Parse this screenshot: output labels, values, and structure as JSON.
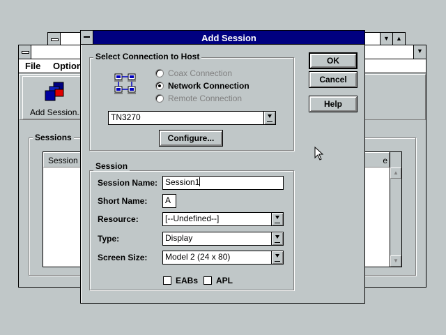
{
  "back_window": {
    "menu": {
      "file": "File",
      "options": "Option"
    },
    "toolbar": {
      "add_session_label": "Add Session..."
    },
    "sessions_group": {
      "title": "Sessions",
      "column_session": "Session N",
      "column_right": "e"
    }
  },
  "dialog": {
    "title": "Add Session",
    "connection_group": {
      "title": "Select Connection to Host",
      "radios": [
        {
          "label": "Coax Connection",
          "selected": false,
          "enabled": false
        },
        {
          "label": "Network Connection",
          "selected": true,
          "enabled": true
        },
        {
          "label": "Remote Connection",
          "selected": false,
          "enabled": false
        }
      ],
      "protocol": "TN3270",
      "configure_label": "Configure..."
    },
    "session_group": {
      "title": "Session",
      "session_name_label": "Session Name:",
      "session_name_value": "Session1",
      "short_name_label": "Short Name:",
      "short_name_value": "A",
      "resource_label": "Resource:",
      "resource_value": "[--Undefined--]",
      "type_label": "Type:",
      "type_value": "Display",
      "screen_size_label": "Screen Size:",
      "screen_size_value": "Model 2 (24 x 80)",
      "eabs_label": "EABs",
      "apl_label": "APL"
    },
    "buttons": {
      "ok": "OK",
      "cancel": "Cancel",
      "help": "Help"
    }
  },
  "colors": {
    "desktop": "#c0c7c8",
    "active_title": "#000080",
    "window_face": "#c0c7c8"
  },
  "icons": [
    "network-computers-icon",
    "add-session-icon",
    "mouse-pointer-icon"
  ]
}
